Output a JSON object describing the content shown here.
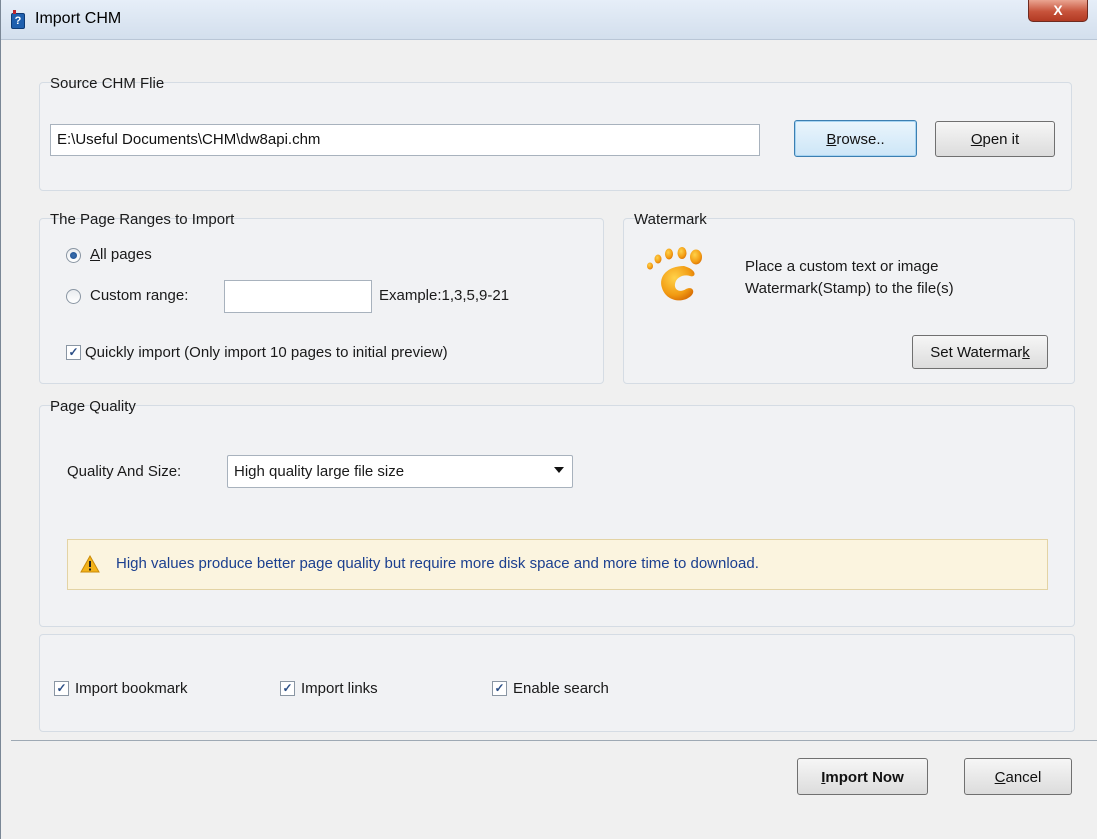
{
  "window": {
    "title": "Import CHM",
    "close_label": "X"
  },
  "source": {
    "group_label": "Source CHM Flie",
    "path_value": "E:\\Useful Documents\\CHM\\dw8api.chm",
    "browse_label_u": "B",
    "browse_label_rest": "rowse..",
    "open_label_u": "O",
    "open_label_rest": "pen it"
  },
  "ranges": {
    "group_label": "The Page Ranges to Import",
    "all_pages_u": "A",
    "all_pages_rest": "ll pages",
    "custom_range_label": "Custom range:",
    "custom_range_value": "",
    "example_text": "Example:1,3,5,9-21",
    "quick_import_label": "Quickly import (Only import 10 pages to  initial  preview)",
    "all_pages_selected": true,
    "quick_import_checked": true
  },
  "watermark": {
    "group_label": "Watermark",
    "description_line1": "Place a custom text or image",
    "description_line2": "Watermark(Stamp) to the file(s)",
    "set_label_main": "Set Watermar",
    "set_label_u": "k",
    "icon": "footprint-icon"
  },
  "quality": {
    "group_label": "Page Quality",
    "quality_label": "Quality And Size:",
    "quality_selected": "High quality large file size",
    "warning_text": "High values produce better page quality but require more disk space and more time to download.",
    "warning_icon": "warning-icon"
  },
  "options": {
    "import_bookmark": "Import bookmark",
    "import_links": "Import links",
    "enable_search": "Enable search",
    "checks": [
      true,
      true,
      true
    ]
  },
  "footer": {
    "import_now_u": "I",
    "import_now_rest": "mport Now",
    "cancel_u": "C",
    "cancel_rest": "ancel"
  },
  "colors": {
    "warning_text": "#1b3f8f",
    "warning_bg": "#fbf4df",
    "default_button_border": "#3c7fb1"
  }
}
